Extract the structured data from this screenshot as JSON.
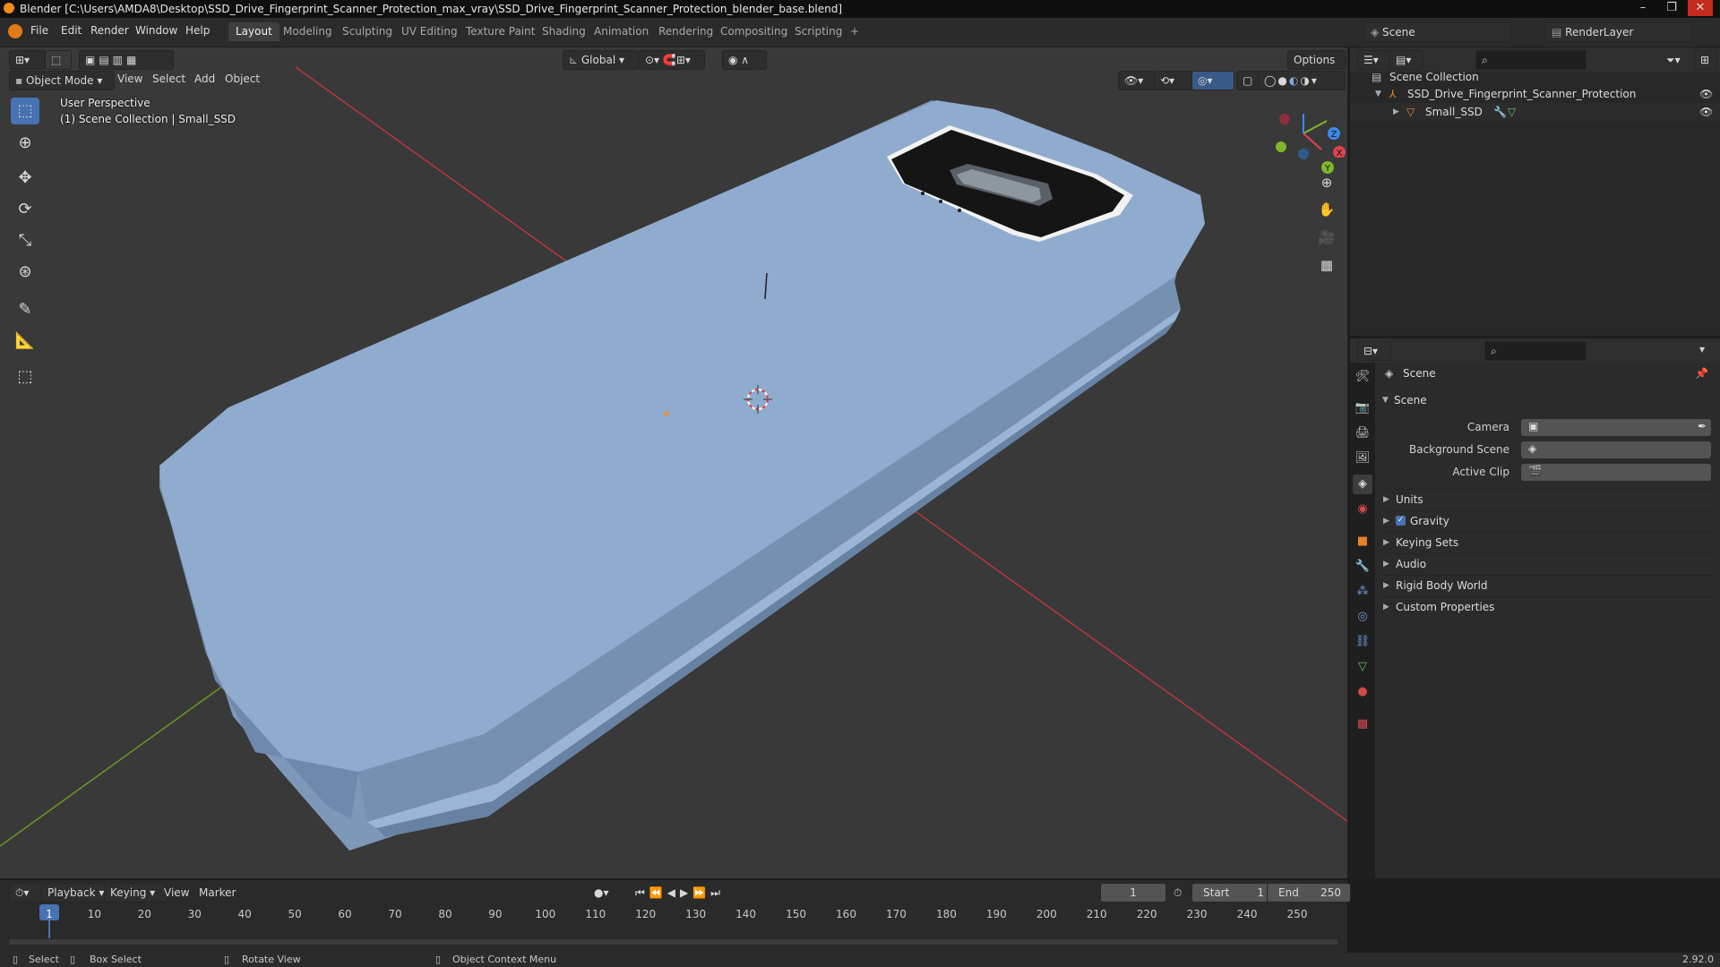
{
  "window": {
    "title": "Blender [C:\\Users\\AMDA8\\Desktop\\SSD_Drive_Fingerprint_Scanner_Protection_max_vray\\SSD_Drive_Fingerprint_Scanner_Protection_blender_base.blend]",
    "controls": [
      "–",
      "❐",
      "✕"
    ]
  },
  "menu": [
    "File",
    "Edit",
    "Render",
    "Window",
    "Help"
  ],
  "workspaces": [
    "Layout",
    "Modeling",
    "Sculpting",
    "UV Editing",
    "Texture Paint",
    "Shading",
    "Animation",
    "Rendering",
    "Compositing",
    "Scripting",
    "+"
  ],
  "active_workspace": "Layout",
  "scene_selector": {
    "scene": "Scene",
    "view_layer": "RenderLayer"
  },
  "viewport": {
    "mode": "Object Mode",
    "menus": [
      "View",
      "Select",
      "Add",
      "Object"
    ],
    "transform_orientation": "Global",
    "options_label": "Options",
    "overlay_line1": "User Perspective",
    "overlay_line2": "(1) Scene Collection | Small_SSD",
    "gizmo_axes": [
      "X",
      "Y",
      "Z"
    ]
  },
  "tools": [
    "select-box",
    "cursor",
    "move",
    "rotate",
    "scale",
    "transform",
    "annotate",
    "measure",
    "add-cube"
  ],
  "outliner": {
    "root": "Scene Collection",
    "items": [
      {
        "label": "SSD_Drive_Fingerprint_Scanner_Protection",
        "level": 1
      },
      {
        "label": "Small_SSD",
        "level": 2
      }
    ]
  },
  "properties": {
    "context": "Scene",
    "panel_title": "Scene",
    "fields": [
      {
        "label": "Camera",
        "value": ""
      },
      {
        "label": "Background Scene",
        "value": ""
      },
      {
        "label": "Active Clip",
        "value": ""
      }
    ],
    "collapsed_panels": [
      "Units",
      "Gravity",
      "Keying Sets",
      "Audio",
      "Rigid Body World",
      "Custom Properties"
    ],
    "gravity_checked": true
  },
  "timeline": {
    "menus": [
      "Playback",
      "Keying",
      "View",
      "Marker"
    ],
    "current_frame": "1",
    "start_label": "Start",
    "start": "1",
    "end_label": "End",
    "end": "250",
    "ticks": [
      "1",
      "10",
      "20",
      "30",
      "40",
      "50",
      "60",
      "70",
      "80",
      "90",
      "100",
      "110",
      "120",
      "130",
      "140",
      "150",
      "160",
      "170",
      "180",
      "190",
      "200",
      "210",
      "220",
      "230",
      "240",
      "250"
    ]
  },
  "statusbar": {
    "select": "Select",
    "box_select": "Box Select",
    "rotate_view": "Rotate View",
    "context_menu": "Object Context Menu",
    "version": "2.92.0"
  },
  "colors": {
    "accent": "#4772b3",
    "viewport_bg": "#393939",
    "object_color": "#8ba7cf",
    "x_axis": "#e0434f",
    "y_axis": "#80b82c",
    "z_axis": "#3b8bea"
  }
}
